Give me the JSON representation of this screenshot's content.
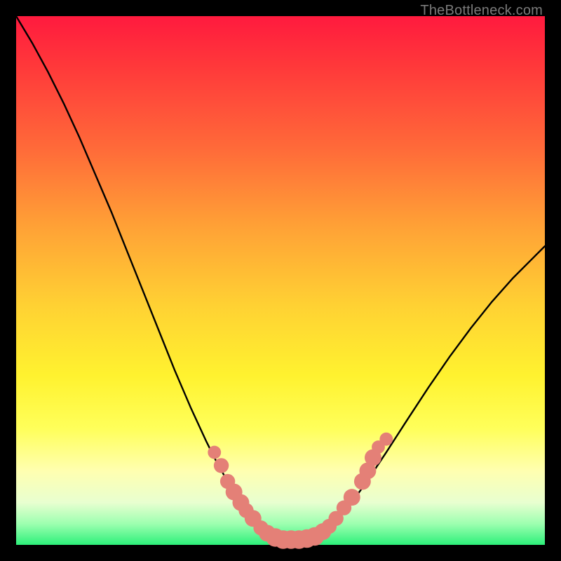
{
  "attribution": "TheBottleneck.com",
  "colors": {
    "curve": "#000000",
    "marker_fill": "#e48077",
    "marker_stroke": "#c86a62",
    "gradient_top": "#ff1a3e",
    "gradient_bottom": "#2df07a",
    "frame": "#000000"
  },
  "chart_data": {
    "type": "line",
    "title": "",
    "xlabel": "",
    "ylabel": "",
    "xlim": [
      0,
      100
    ],
    "ylim": [
      0,
      100
    ],
    "grid": false,
    "legend": false,
    "series": [
      {
        "name": "bottleneck-curve",
        "x": [
          0,
          3,
          6,
          9,
          12,
          15,
          18,
          21,
          24,
          27,
          30,
          33,
          36,
          38,
          40,
          42,
          44,
          46,
          48,
          50,
          52,
          54,
          56,
          58,
          60,
          63,
          66,
          70,
          74,
          78,
          82,
          86,
          90,
          94,
          98,
          100
        ],
        "y": [
          100,
          95,
          89.5,
          83.5,
          77,
          70,
          63,
          55.5,
          48,
          40.5,
          33,
          26,
          19.5,
          15.5,
          12,
          9,
          6.3,
          4.2,
          2.6,
          1.5,
          1.0,
          1.0,
          1.4,
          2.4,
          4.0,
          7.4,
          11.5,
          17.5,
          23.7,
          29.8,
          35.6,
          41.0,
          46.0,
          50.5,
          54.5,
          56.5
        ]
      }
    ],
    "markers": [
      {
        "x": 37.5,
        "y": 17.5,
        "r": 1.0
      },
      {
        "x": 38.8,
        "y": 15.0,
        "r": 1.2
      },
      {
        "x": 40.0,
        "y": 12.0,
        "r": 1.2
      },
      {
        "x": 41.2,
        "y": 10.0,
        "r": 1.4
      },
      {
        "x": 42.5,
        "y": 8.0,
        "r": 1.4
      },
      {
        "x": 43.5,
        "y": 6.5,
        "r": 1.2
      },
      {
        "x": 44.8,
        "y": 5.0,
        "r": 1.4
      },
      {
        "x": 46.3,
        "y": 3.2,
        "r": 1.2
      },
      {
        "x": 47.5,
        "y": 2.2,
        "r": 1.4
      },
      {
        "x": 49.0,
        "y": 1.4,
        "r": 1.6
      },
      {
        "x": 50.5,
        "y": 1.0,
        "r": 1.6
      },
      {
        "x": 52.0,
        "y": 1.0,
        "r": 1.6
      },
      {
        "x": 53.5,
        "y": 1.0,
        "r": 1.6
      },
      {
        "x": 55.0,
        "y": 1.2,
        "r": 1.6
      },
      {
        "x": 56.5,
        "y": 1.6,
        "r": 1.6
      },
      {
        "x": 58.0,
        "y": 2.5,
        "r": 1.4
      },
      {
        "x": 59.2,
        "y": 3.5,
        "r": 1.2
      },
      {
        "x": 60.5,
        "y": 5.0,
        "r": 1.2
      },
      {
        "x": 62.0,
        "y": 7.0,
        "r": 1.2
      },
      {
        "x": 63.5,
        "y": 9.0,
        "r": 1.4
      },
      {
        "x": 65.5,
        "y": 12.0,
        "r": 1.4
      },
      {
        "x": 66.5,
        "y": 14.0,
        "r": 1.4
      },
      {
        "x": 67.5,
        "y": 16.5,
        "r": 1.4
      },
      {
        "x": 68.5,
        "y": 18.5,
        "r": 1.0
      },
      {
        "x": 70.0,
        "y": 20.0,
        "r": 1.0
      }
    ]
  }
}
